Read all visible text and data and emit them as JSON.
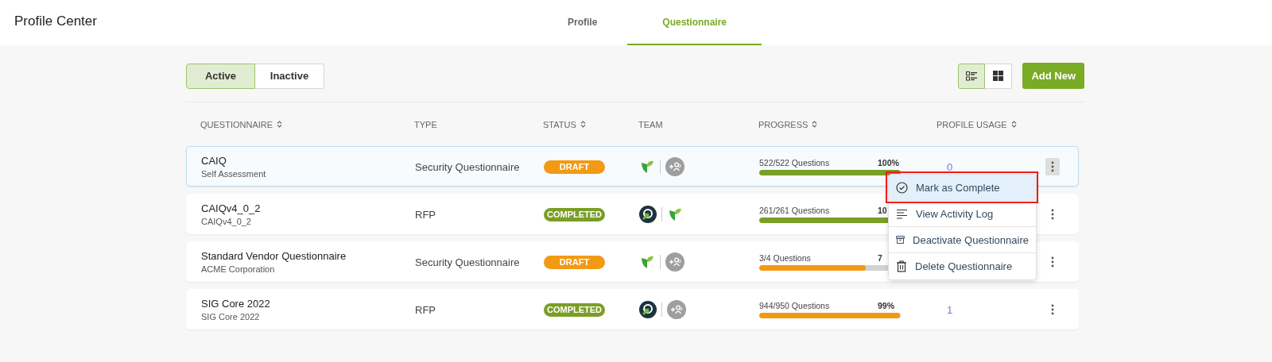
{
  "app_title": "Profile Center",
  "tabs": [
    {
      "label": "Profile",
      "selected": false
    },
    {
      "label": "Questionnaire",
      "selected": true
    }
  ],
  "filter_toggle": [
    {
      "label": "Active",
      "selected": true
    },
    {
      "label": "Inactive",
      "selected": false
    }
  ],
  "view_toggle": [
    {
      "kind": "list",
      "selected": true
    },
    {
      "kind": "grid",
      "selected": false
    }
  ],
  "add_button": "Add New",
  "columns": [
    {
      "label": "QUESTIONNAIRE",
      "sortable": true
    },
    {
      "label": "TYPE",
      "sortable": false
    },
    {
      "label": "STATUS",
      "sortable": true
    },
    {
      "label": "TEAM",
      "sortable": false
    },
    {
      "label": "PROGRESS",
      "sortable": true
    },
    {
      "label": "PROFILE USAGE",
      "sortable": true
    }
  ],
  "rows": [
    {
      "name": "CAIQ",
      "subtitle": "Self Assessment",
      "type": "Security Questionnaire",
      "status": {
        "label": "DRAFT",
        "kind": "draft"
      },
      "team": [
        {
          "kind": "leaf"
        },
        {
          "kind": "add"
        }
      ],
      "progress": {
        "text": "522/522 Questions",
        "percent": "100%",
        "level": 1
      },
      "usage": "0",
      "selected": true,
      "menu_open": true
    },
    {
      "name": "CAIQv4_0_2",
      "subtitle": "CAIQv4_0_2",
      "type": "RFP",
      "status": {
        "label": "COMPLETED",
        "kind": "completed"
      },
      "team": [
        {
          "kind": "r-logo"
        },
        {
          "kind": "leaf"
        }
      ],
      "progress": {
        "text": "261/261 Questions",
        "percent": "10",
        "level": 1
      },
      "selected": false,
      "menu_open": false
    },
    {
      "name": "Standard Vendor Questionnaire",
      "subtitle": "ACME Corporation",
      "type": "Security Questionnaire",
      "status": {
        "label": "DRAFT",
        "kind": "draft"
      },
      "team": [
        {
          "kind": "leaf"
        },
        {
          "kind": "add"
        }
      ],
      "progress": {
        "text": "3/4 Questions",
        "percent": "7",
        "level": 0.75
      },
      "selected": false,
      "menu_open": false
    },
    {
      "name": "SIG Core 2022",
      "subtitle": "SIG Core 2022",
      "type": "RFP",
      "status": {
        "label": "COMPLETED",
        "kind": "completed"
      },
      "team": [
        {
          "kind": "r-logo"
        },
        {
          "kind": "add"
        }
      ],
      "progress": {
        "text": "944/950 Questions",
        "percent": "99%",
        "level": 0.9937
      },
      "usage": "1",
      "selected": false,
      "menu_open": false
    }
  ],
  "context_menu": [
    {
      "label": "Mark as Complete",
      "kind": "check",
      "selected": true
    },
    {
      "label": "View Activity Log",
      "kind": "lines",
      "selected": false
    },
    {
      "label": "Deactivate Questionnaire",
      "kind": "archive",
      "selected": false
    },
    {
      "label": "Delete Questionnaire",
      "kind": "trash",
      "selected": false
    }
  ]
}
